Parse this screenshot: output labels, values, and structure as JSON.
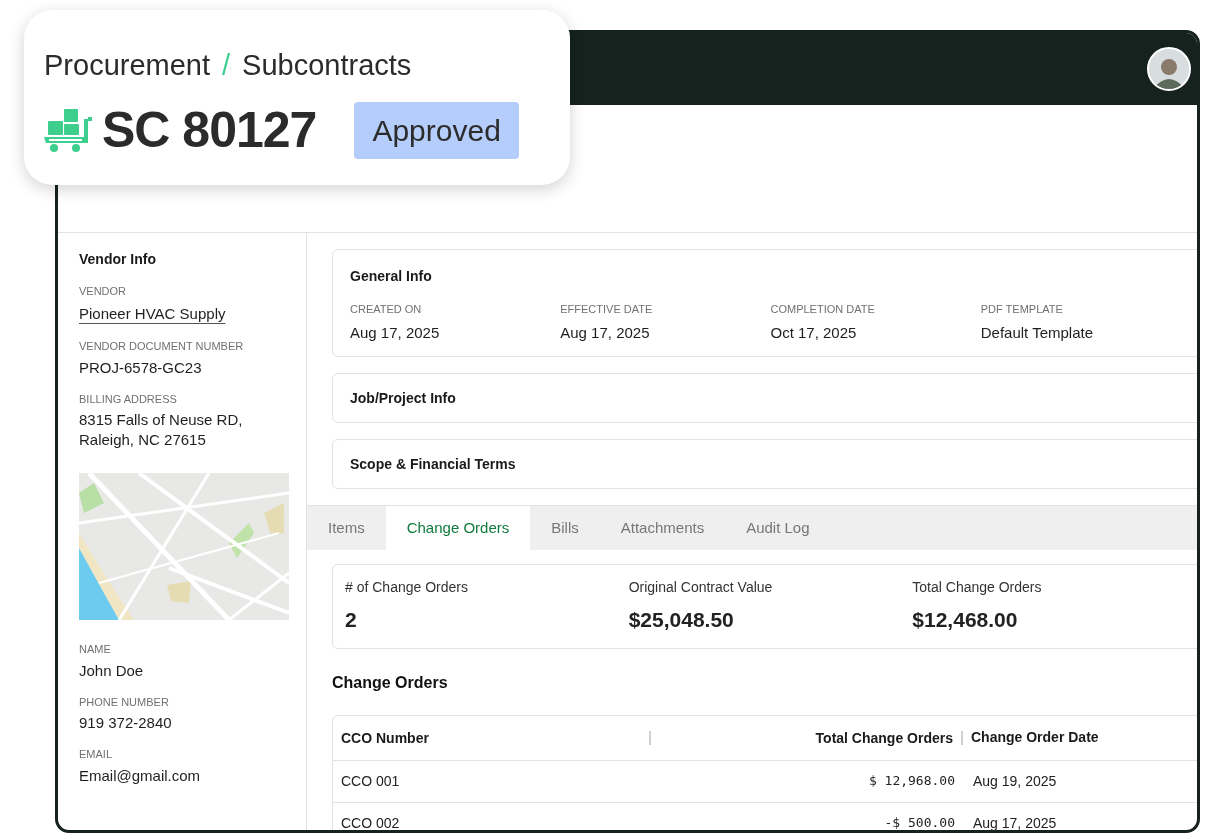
{
  "breadcrumb": {
    "items": [
      "Procurement",
      "Subcontracts"
    ],
    "separator": "/"
  },
  "title": "SC 80127",
  "status": {
    "label": "Approved",
    "kind": "approved"
  },
  "vendor_info": {
    "heading": "Vendor Info",
    "fields": [
      {
        "label": "VENDOR",
        "value": "Pioneer HVAC Supply",
        "kind": "link"
      },
      {
        "label": "VENDOR DOCUMENT NUMBER",
        "value": "PROJ-6578-GC23",
        "kind": "text"
      },
      {
        "label": "BILLING ADDRESS",
        "value": "8315 Falls of Neuse RD,\nRaleigh, NC 27615",
        "kind": "text"
      }
    ],
    "contact_fields": [
      {
        "label": "NAME",
        "value": "John Doe",
        "kind": "text"
      },
      {
        "label": "PHONE NUMBER",
        "value": "919 372-2840",
        "kind": "text"
      },
      {
        "label": "EMAIL",
        "value": "Email@gmail.com",
        "kind": "text"
      }
    ]
  },
  "general_info": {
    "title": "General Info",
    "fields": [
      {
        "label": "CREATED ON",
        "value": "Aug 17, 2025"
      },
      {
        "label": "EFFECTIVE DATE",
        "value": "Aug 17, 2025"
      },
      {
        "label": "COMPLETION DATE",
        "value": "Oct 17, 2025"
      },
      {
        "label": "PDF TEMPLATE",
        "value": "Default Template"
      }
    ]
  },
  "sections": [
    {
      "title": "Job/Project Info"
    },
    {
      "title": "Scope & Financial Terms"
    }
  ],
  "tabs": [
    {
      "label": "Items",
      "selected": false
    },
    {
      "label": "Change Orders",
      "selected": true
    },
    {
      "label": "Bills",
      "selected": false
    },
    {
      "label": "Attachments",
      "selected": false
    },
    {
      "label": "Audit Log",
      "selected": false
    }
  ],
  "summary": [
    {
      "label": "# of Change Orders",
      "value": "2"
    },
    {
      "label": "Original Contract Value",
      "value": "$25,048.50"
    },
    {
      "label": "Total Change Orders",
      "value": "$12,468.00"
    }
  ],
  "change_orders": {
    "title": "Change Orders",
    "columns": [
      "CCO Number",
      "Total Change Orders",
      "Change Order Date"
    ],
    "rows": [
      [
        "CCO 001",
        "$ 12,968.00",
        "Aug 19, 2025"
      ],
      [
        "CCO 002",
        "-$ 500.00",
        "Aug 17, 2025"
      ]
    ]
  }
}
